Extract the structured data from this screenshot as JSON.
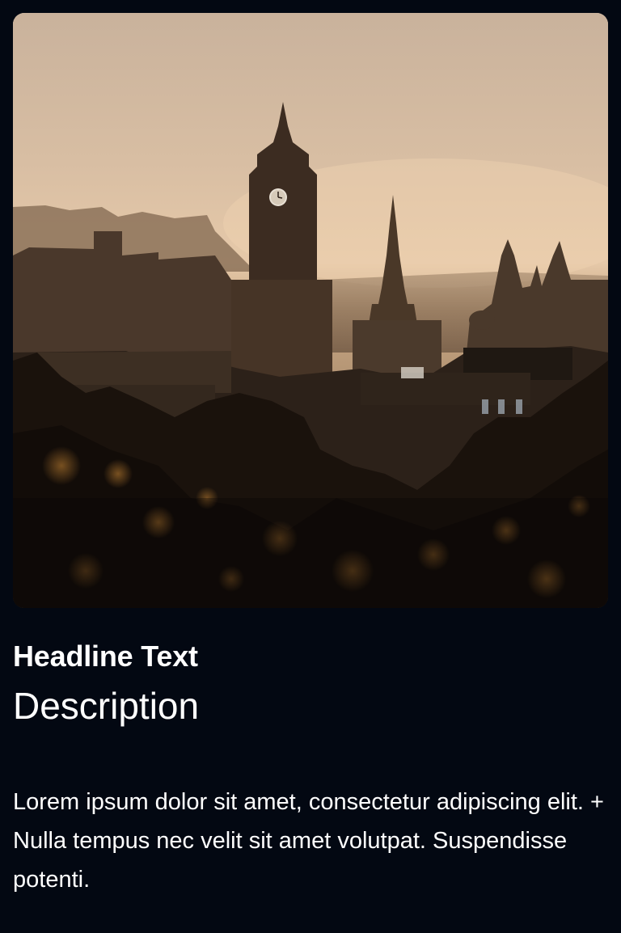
{
  "card": {
    "image": {
      "alt_icon": "city-skyline-photo"
    },
    "headline": "Headline Text",
    "description": "Description",
    "body": "Lorem ipsum dolor sit amet, consectetur adipiscing elit. + Nulla tempus nec velit sit amet volutpat. Suspendisse potenti."
  },
  "colors": {
    "background": "#030812",
    "text": "#ffffff",
    "sky": "#d9c0a6"
  }
}
